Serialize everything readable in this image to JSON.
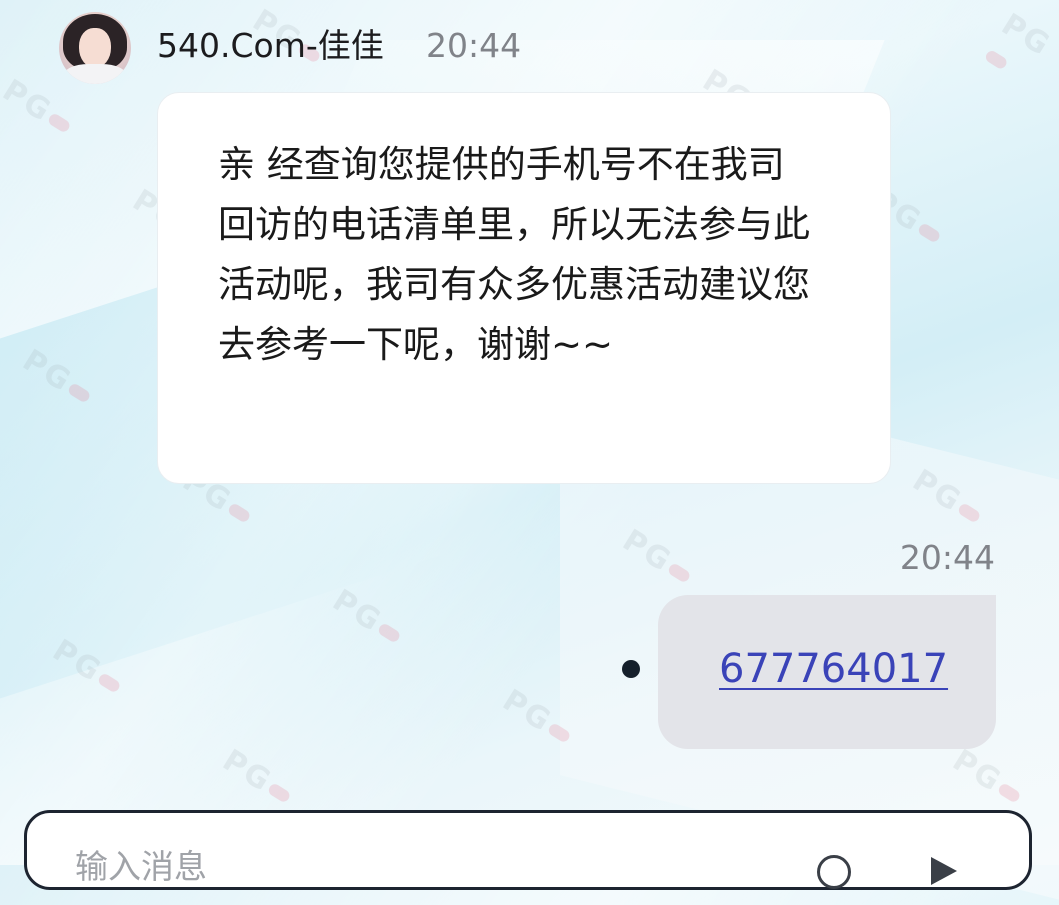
{
  "header": {
    "sender_name": "540.Com-佳佳",
    "time": "20:44"
  },
  "incoming_message": {
    "text": "亲 经查询您提供的手机号不在我司回访的电话清单里，所以无法参与此活动呢，我司有众多优惠活动建议您去参考一下呢，谢谢~~"
  },
  "outgoing_message": {
    "time": "20:44",
    "link_text": "677764017"
  },
  "input": {
    "placeholder": "输入消息"
  },
  "watermark": {
    "text": "PG"
  },
  "colors": {
    "link": "#3a43b8",
    "outgoing_bubble": "#e3e4e9",
    "incoming_bubble": "#ffffff"
  }
}
